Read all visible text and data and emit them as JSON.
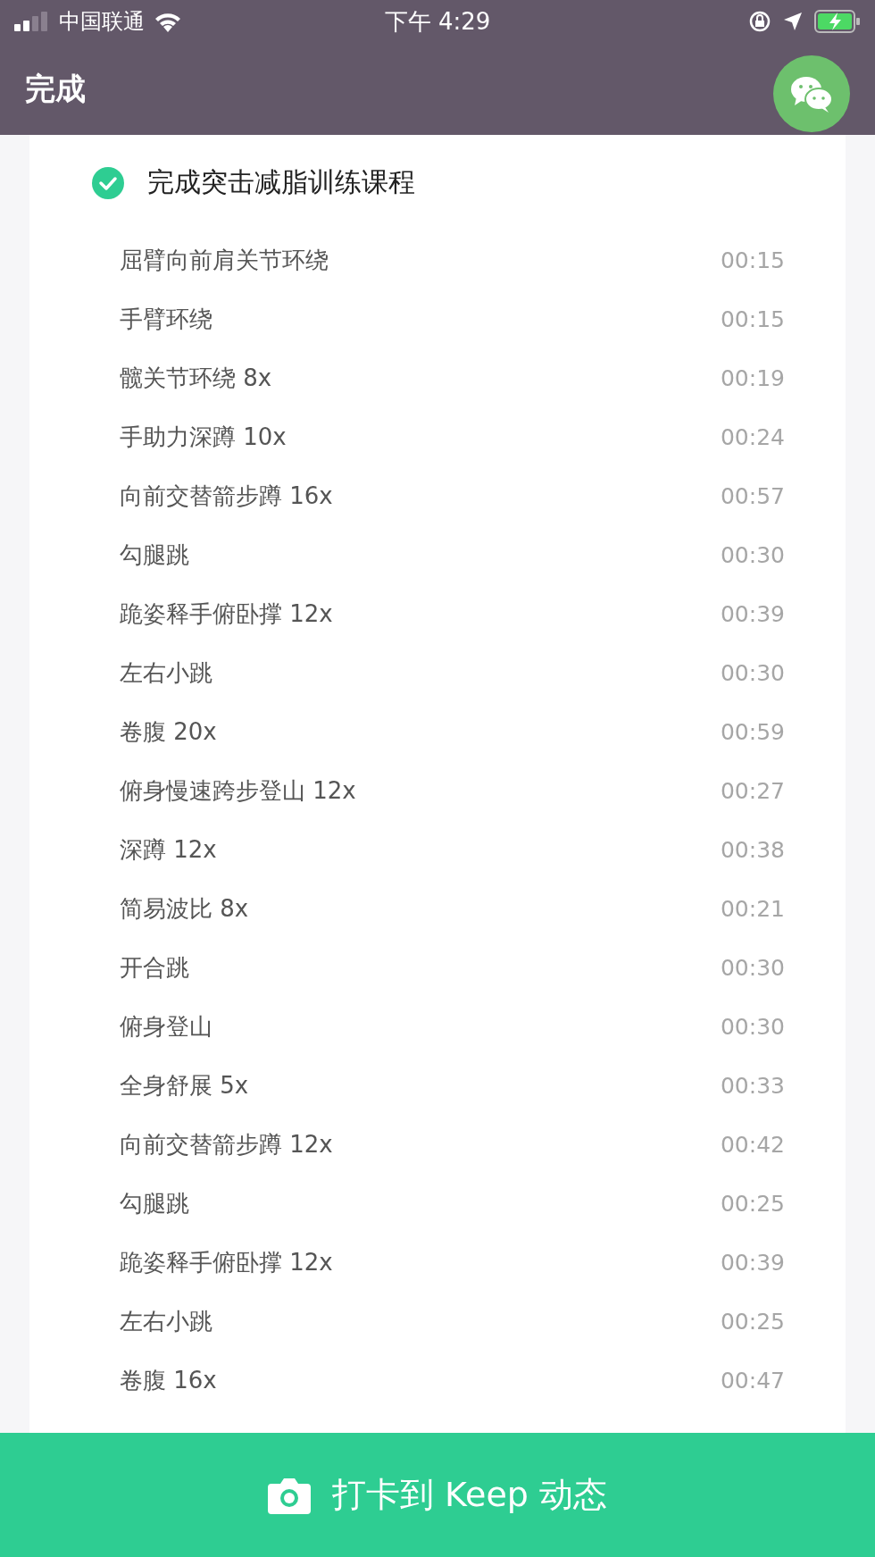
{
  "status_bar": {
    "carrier": "中国联通",
    "time": "下午 4:29"
  },
  "nav": {
    "title": "完成"
  },
  "course": {
    "title": "完成突击减脂训练课程",
    "completed": true,
    "exercises": [
      {
        "name": "屈臂向前肩关节环绕",
        "time": "00:15"
      },
      {
        "name": "手臂环绕",
        "time": "00:15"
      },
      {
        "name": "髋关节环绕 8x",
        "time": "00:19"
      },
      {
        "name": "手助力深蹲 10x",
        "time": "00:24"
      },
      {
        "name": "向前交替箭步蹲 16x",
        "time": "00:57"
      },
      {
        "name": "勾腿跳",
        "time": "00:30"
      },
      {
        "name": "跪姿释手俯卧撑 12x",
        "time": "00:39"
      },
      {
        "name": "左右小跳",
        "time": "00:30"
      },
      {
        "name": "卷腹 20x",
        "time": "00:59"
      },
      {
        "name": "俯身慢速跨步登山 12x",
        "time": "00:27"
      },
      {
        "name": "深蹲 12x",
        "time": "00:38"
      },
      {
        "name": "简易波比 8x",
        "time": "00:21"
      },
      {
        "name": "开合跳",
        "time": "00:30"
      },
      {
        "name": "俯身登山",
        "time": "00:30"
      },
      {
        "name": "全身舒展 5x",
        "time": "00:33"
      },
      {
        "name": "向前交替箭步蹲 12x",
        "time": "00:42"
      },
      {
        "name": "勾腿跳",
        "time": "00:25"
      },
      {
        "name": "跪姿释手俯卧撑 12x",
        "time": "00:39"
      },
      {
        "name": "左右小跳",
        "time": "00:25"
      },
      {
        "name": "卷腹 16x",
        "time": "00:47"
      }
    ]
  },
  "share_button": {
    "label": "打卡到 Keep 动态"
  }
}
